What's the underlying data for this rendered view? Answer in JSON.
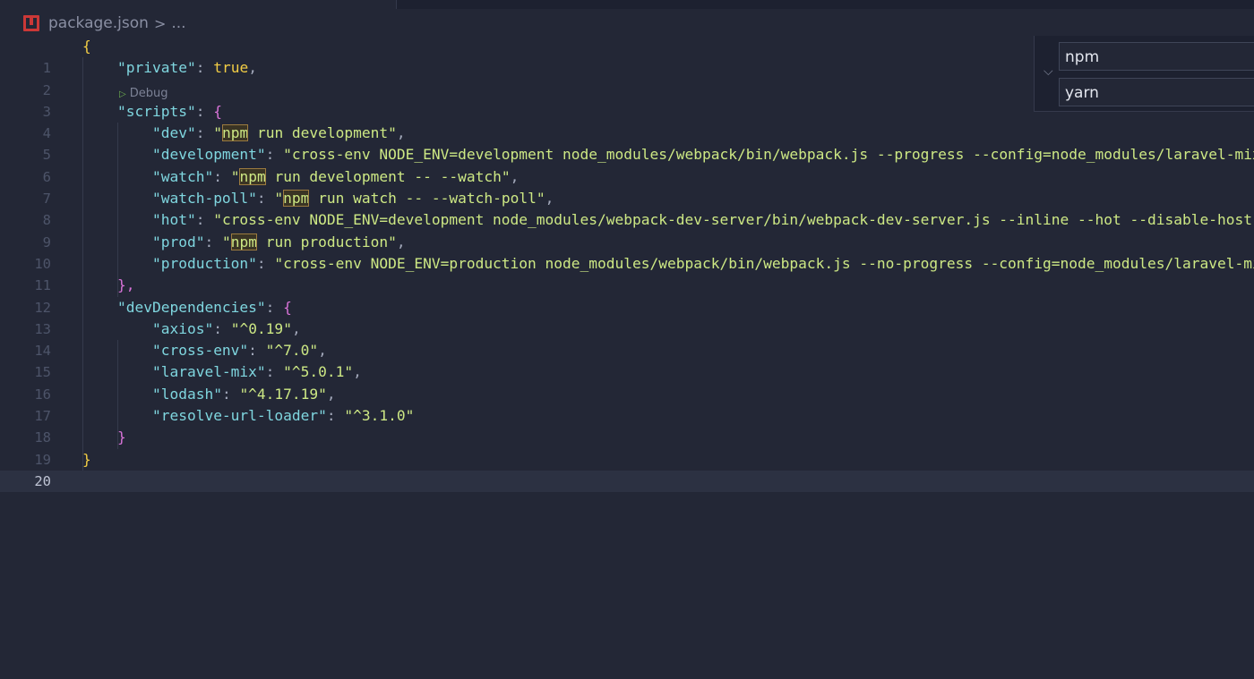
{
  "breadcrumb": {
    "file": "package.json",
    "separator": ">",
    "more": "..."
  },
  "codelens": {
    "label": "Debug"
  },
  "suggest": {
    "options": [
      "npm",
      "yarn"
    ]
  },
  "lines": [
    {
      "n": "1",
      "c": "{"
    },
    {
      "n": "2",
      "c": "\"private\": true,"
    },
    {
      "n": "3",
      "c": "\"scripts\": {"
    },
    {
      "n": "4",
      "c": "\"dev\": \"npm run development\","
    },
    {
      "n": "5",
      "c": "\"development\": \"cross-env NODE_ENV=development node_modules/webpack/bin/webpack.js --progress --config=node_modules/laravel-mix"
    },
    {
      "n": "6",
      "c": "\"watch\": \"npm run development -- --watch\","
    },
    {
      "n": "7",
      "c": "\"watch-poll\": \"npm run watch -- --watch-poll\","
    },
    {
      "n": "8",
      "c": "\"hot\": \"cross-env NODE_ENV=development node_modules/webpack-dev-server/bin/webpack-dev-server.js --inline --hot --disable-host-"
    },
    {
      "n": "9",
      "c": "\"prod\": \"npm run production\","
    },
    {
      "n": "10",
      "c": "\"production\": \"cross-env NODE_ENV=production node_modules/webpack/bin/webpack.js --no-progress --config=node_modules/laravel-mi"
    },
    {
      "n": "11",
      "c": "},"
    },
    {
      "n": "12",
      "c": "\"devDependencies\": {"
    },
    {
      "n": "13",
      "c": "\"axios\": \"^0.19\","
    },
    {
      "n": "14",
      "c": "\"cross-env\": \"^7.0\","
    },
    {
      "n": "15",
      "c": "\"laravel-mix\": \"^5.0.1\","
    },
    {
      "n": "16",
      "c": "\"lodash\": \"^4.17.19\","
    },
    {
      "n": "17",
      "c": "\"resolve-url-loader\": \"^3.1.0\""
    },
    {
      "n": "18",
      "c": "}"
    },
    {
      "n": "19",
      "c": "}"
    },
    {
      "n": "20",
      "c": ""
    }
  ]
}
